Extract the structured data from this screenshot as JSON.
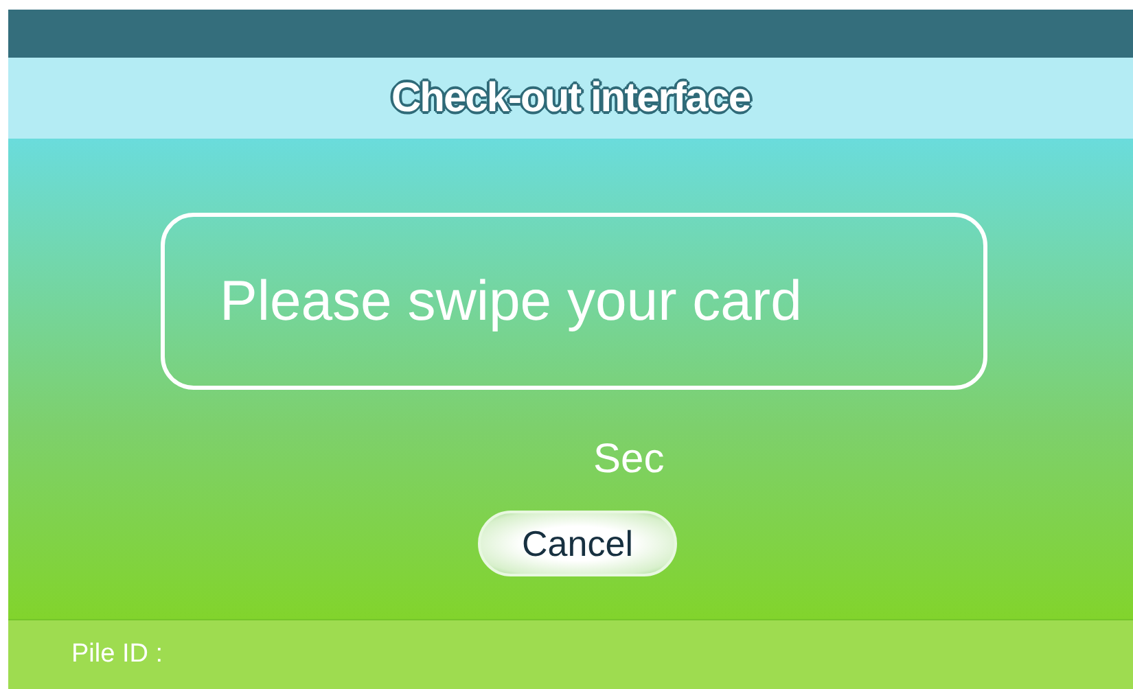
{
  "header": {
    "title": "Check-out interface"
  },
  "prompt": {
    "message": "Please swipe your card"
  },
  "countdown": {
    "unit": "Sec"
  },
  "buttons": [
    {
      "label": "Cancel"
    }
  ],
  "footer": {
    "label": "Pile ID :"
  }
}
